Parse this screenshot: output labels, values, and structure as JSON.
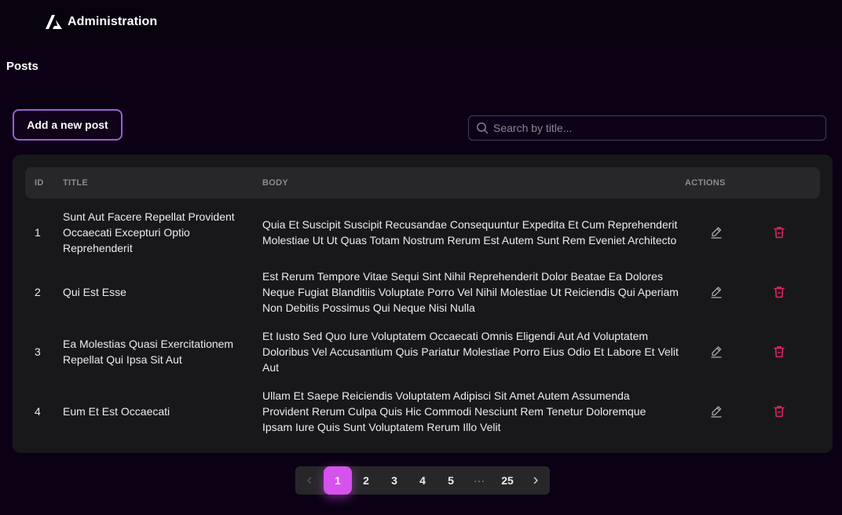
{
  "header": {
    "title": "Administration",
    "logo_icon": "triangle-logo-icon"
  },
  "page": {
    "title": "Posts"
  },
  "toolbar": {
    "add_label": "Add a new post",
    "search_placeholder": "Search by title...",
    "search_value": ""
  },
  "table": {
    "columns": {
      "id": "ID",
      "title": "TITLE",
      "body": "BODY",
      "actions": "ACTIONS"
    },
    "rows": [
      {
        "id": "1",
        "title": "Sunt Aut Facere Repellat Provident Occaecati Excepturi Optio Reprehenderit",
        "body": "Quia Et Suscipit Suscipit Recusandae Consequuntur Expedita Et Cum Reprehenderit Molestiae Ut Ut Quas Totam Nostrum Rerum Est Autem Sunt Rem Eveniet Architecto"
      },
      {
        "id": "2",
        "title": "Qui Est Esse",
        "body": "Est Rerum Tempore Vitae Sequi Sint Nihil Reprehenderit Dolor Beatae Ea Dolores Neque Fugiat Blanditiis Voluptate Porro Vel Nihil Molestiae Ut Reiciendis Qui Aperiam Non Debitis Possimus Qui Neque Nisi Nulla"
      },
      {
        "id": "3",
        "title": "Ea Molestias Quasi Exercitationem Repellat Qui Ipsa Sit Aut",
        "body": "Et Iusto Sed Quo Iure Voluptatem Occaecati Omnis Eligendi Aut Ad Voluptatem Doloribus Vel Accusantium Quis Pariatur Molestiae Porro Eius Odio Et Labore Et Velit Aut"
      },
      {
        "id": "4",
        "title": "Eum Et Est Occaecati",
        "body": "Ullam Et Saepe Reiciendis Voluptatem Adipisci Sit Amet Autem Assumenda Provident Rerum Culpa Quis Hic Commodi Nesciunt Rem Tenetur Doloremque Ipsam Iure Quis Sunt Voluptatem Rerum Illo Velit"
      }
    ]
  },
  "pagination": {
    "current": "1",
    "pages": [
      "1",
      "2",
      "3",
      "4",
      "5"
    ],
    "ellipsis": "···",
    "last": "25"
  },
  "colors": {
    "accent": "#d552ed",
    "button_border": "#9a5fd6",
    "delete": "#e0245e",
    "background": "#0c0015",
    "card": "#18181b"
  }
}
